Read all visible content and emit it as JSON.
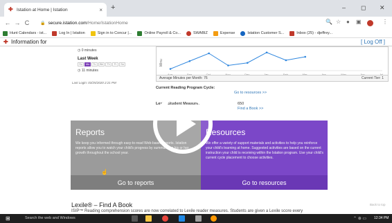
{
  "browser": {
    "tab_title": "Istation at Home | Istation",
    "tab_close": "×",
    "new_tab": "+",
    "win_min": "–",
    "win_max": "◻",
    "win_close": "✕",
    "nav_back": "←",
    "nav_forward": "→",
    "nav_reload": "C",
    "url_host": "secure.istation.com",
    "url_path": "/Home/IstationHome",
    "bookmarks": [
      {
        "label": "Hunt Calendars - ist...",
        "color": "#2e7d32"
      },
      {
        "label": "Log In | Istation",
        "color": "#c0392b"
      },
      {
        "label": "Sign in to Concur |...",
        "color": "#f1c40f"
      },
      {
        "label": "Online Payroll & Co...",
        "color": "#2e7d32"
      },
      {
        "label": "SWABIZ",
        "color": "#c0392b"
      },
      {
        "label": "Expense",
        "color": "#f39c12"
      },
      {
        "label": "Istation Customer S...",
        "color": "#1565c0"
      },
      {
        "label": "Inbox (25) - djeffrey...",
        "color": "#c0392b"
      }
    ]
  },
  "site": {
    "title": "Information for",
    "logoff": "[ Log Off ]"
  },
  "left": {
    "minutes_a": "0 minutes",
    "last_week": "Last Week",
    "days": [
      "Su",
      "Mo",
      "Tu",
      "We",
      "Th",
      "Fr",
      "Sa"
    ],
    "minutes_b": "11 minutes",
    "last_login": "Last Login: 03/25/2020 2:21 PM"
  },
  "chart": {
    "ylabel": "Minu",
    "months": [
      "Aug",
      "Sep",
      "Oct",
      "Nov",
      "Dec",
      "Jan",
      "Feb",
      "Mar",
      "Apr",
      "May",
      "Jun",
      "Jul"
    ],
    "avg": "Average Minutes per Month: 76",
    "tier": "Current Tier: 1"
  },
  "chart_data": {
    "type": "line",
    "categories": [
      "Aug",
      "Sep",
      "Oct",
      "Nov",
      "Dec",
      "Jan",
      "Feb",
      "Mar",
      "Apr",
      "May",
      "Jun",
      "Jul"
    ],
    "values": [
      10,
      55,
      100,
      30,
      45,
      105,
      60,
      80,
      null,
      null,
      null,
      null
    ],
    "ylabel": "Minu",
    "ylim": [
      0,
      120
    ]
  },
  "program": {
    "cycle_label": "Current Reading Program Cycle:",
    "cycle_link": "Go to resources >>",
    "lexile_label": "Lexile Student Measure:",
    "lexile_value": "650",
    "lexile_link": "Find a Book >>"
  },
  "reports": {
    "title": "Reports",
    "body": "We keep you informed through easy-to-read Web-based reports. Istation reports allow you to watch your child's progress by summarizing his or her growth throughout the school year.",
    "button": "Go to reports"
  },
  "resources": {
    "title": "Resources",
    "body": "We offer a variety of support materials and activities to help you reinforce your child's learning at home. Suggested activities are based on the current instruction your child is receiving within the Istation program. Use your child's current cycle placement to choose activities.",
    "button": "Go to resources"
  },
  "lexile": {
    "title": "Lexile® – Find A Book",
    "text": "ISIP™ Reading comprehension scores are now correlated to Lexile reader measures. Students are given a Lexile score every",
    "back_to_top": "Back to top"
  },
  "taskbar": {
    "search": "Search the web and Windows",
    "time": "12:34 PM"
  }
}
